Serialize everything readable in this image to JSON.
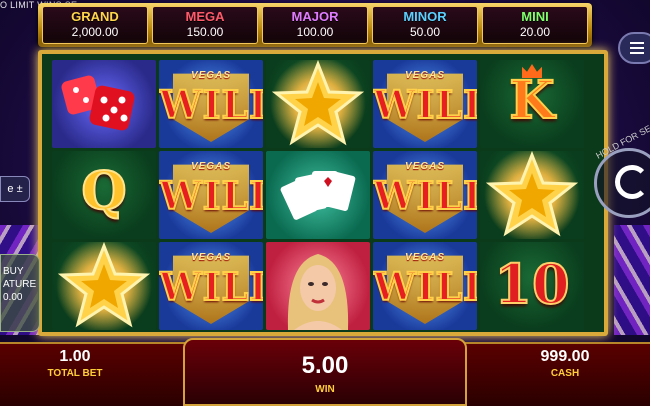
{
  "ticker": "O LIMIT WINS SE",
  "jackpots": [
    {
      "title": "GRAND",
      "value": "2,000.00",
      "key": "grand"
    },
    {
      "title": "MEGA",
      "value": "150.00",
      "key": "mega"
    },
    {
      "title": "MAJOR",
      "value": "100.00",
      "key": "major"
    },
    {
      "title": "MINOR",
      "value": "50.00",
      "key": "minor"
    },
    {
      "title": "MINI",
      "value": "20.00",
      "key": "mini"
    }
  ],
  "reels": {
    "wild_small": "VEGAS",
    "wild_big": "WILD",
    "letter_k": "K",
    "letter_q": "Q",
    "ten": "10"
  },
  "hud": {
    "total_bet_value": "1.00",
    "total_bet_label": "TOTAL BET",
    "win_value": "5.00",
    "win_label": "WIN",
    "cash_value": "999.00",
    "cash_label": "CASH"
  },
  "side": {
    "bet_adjust": "e ±",
    "buy_line1": "BUY",
    "buy_line2": "ATURE",
    "buy_line3": "0.00",
    "hold_text": "HOLD FOR SE"
  },
  "symbols_layout": [
    [
      "dice",
      "wild",
      "star",
      "wild",
      "king"
    ],
    [
      "queen",
      "wild",
      "cards",
      "wild",
      "star"
    ],
    [
      "star",
      "wild",
      "woman",
      "wild",
      "ten"
    ]
  ]
}
